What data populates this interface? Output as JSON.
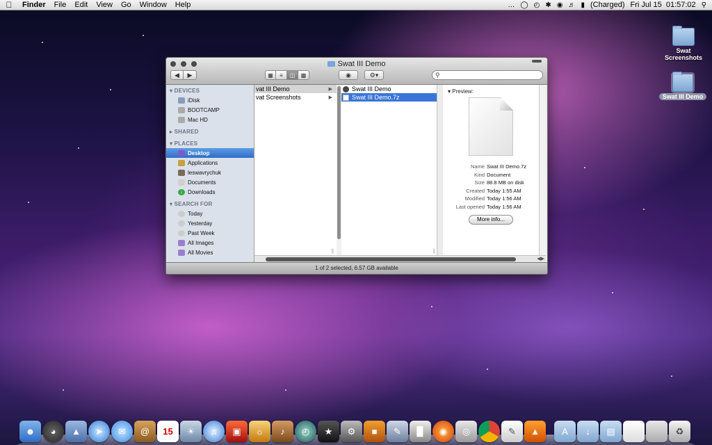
{
  "menubar": {
    "app_name": "Finder",
    "menus": [
      "File",
      "Edit",
      "View",
      "Go",
      "Window",
      "Help"
    ],
    "battery_status": "(Charged)",
    "datetime": "Fri Jul 15  01:57:02"
  },
  "window": {
    "title": "Swat III Demo",
    "status": "1 of 2 selected, 6.57 GB available",
    "sidebar": {
      "devices_header": "DEVICES",
      "devices": [
        "iDisk",
        "BOOTCAMP",
        "Mac HD"
      ],
      "shared_header": "SHARED",
      "places_header": "PLACES",
      "places": [
        "Desktop",
        "Applications",
        "leswavrychuk",
        "Documents",
        "Downloads"
      ],
      "search_header": "SEARCH FOR",
      "searches": [
        "Today",
        "Yesterday",
        "Past Week",
        "All Images",
        "All Movies"
      ]
    },
    "column1": [
      "vat III Demo",
      "vat Screenshots"
    ],
    "column2": [
      "Swat III Demo",
      "Swat III Demo.7z"
    ],
    "preview": {
      "label": "Preview:",
      "info": [
        {
          "k": "Name",
          "v": "Swat III Demo.7z"
        },
        {
          "k": "Kind",
          "v": "Document"
        },
        {
          "k": "Size",
          "v": "88.8 MB on disk"
        },
        {
          "k": "Created",
          "v": "Today 1:55 AM"
        },
        {
          "k": "Modified",
          "v": "Today 1:56 AM"
        },
        {
          "k": "Last opened",
          "v": "Today 1:56 AM"
        }
      ],
      "more_info_label": "More info..."
    }
  },
  "desktop": {
    "icon1": "Swat\nScreenshots",
    "icon1_line1": "Swat",
    "icon1_line2": "Screenshots",
    "icon2": "Swat III Demo"
  },
  "dock": {
    "calendar_day": "15"
  },
  "colors": {
    "selection": "#3875d7",
    "sidebar_bg": "#dbe1ea"
  }
}
